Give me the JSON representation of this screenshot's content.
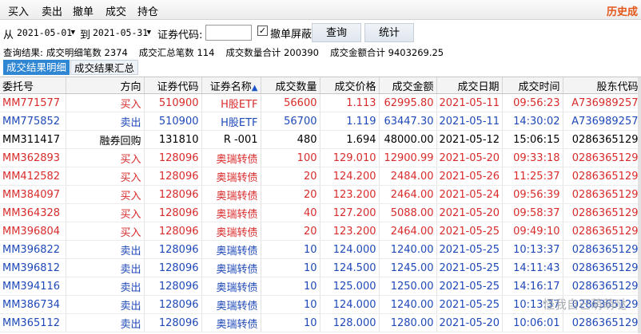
{
  "menu": {
    "items": [
      "买入",
      "卖出",
      "撤单",
      "成交",
      "持仓"
    ],
    "right_label": "历史成"
  },
  "toolbar": {
    "from_label": "从",
    "from_date": "2021-05-01",
    "to_label": "到",
    "to_date": "2021-05-31",
    "code_label": "证券代码:",
    "code_value": "",
    "filter_checked": true,
    "filter_label": "撤单屏蔽",
    "query_button": "查询",
    "stats_button": "统计"
  },
  "summary": {
    "prefix": "查询结果:",
    "detail_count": "成交明细笔数 2374",
    "summary_count": "成交汇总笔数 114",
    "qty_total": "成交数量合计 200390",
    "amount_total": "成交金额合计 9403269.25"
  },
  "tabs": [
    "成交结果明细",
    "成交结果汇总"
  ],
  "colors": {
    "buy": "#d92b2b",
    "sell": "#1f49b8",
    "neutral": "#000000",
    "tab_active": "#2f86d3",
    "header_right": "#e4571a"
  },
  "table": {
    "headers": [
      "委托号",
      "方向",
      "证券代码",
      "证券名称",
      "成交数量",
      "成交价格",
      "成交金额",
      "成交日期",
      "成交时间",
      "股东代码"
    ],
    "sort_indicator": "▲",
    "rows": [
      {
        "side": "buy",
        "cells": [
          "MM771577",
          "买入",
          "510900",
          "H股ETF",
          "56600",
          "1.113",
          "62995.80",
          "2021-05-11",
          "09:56:23",
          "A736989257"
        ]
      },
      {
        "side": "sell",
        "cells": [
          "MM775852",
          "卖出",
          "510900",
          "H股ETF",
          "56700",
          "1.119",
          "63447.30",
          "2021-05-11",
          "14:30:02",
          "A736989257"
        ]
      },
      {
        "side": "neutral",
        "cells": [
          "MM311417",
          "融券回购",
          "131810",
          "R -001",
          "480",
          "1.694",
          "48000.00",
          "2021-05-12",
          "15:06:15",
          "0286365129"
        ]
      },
      {
        "side": "buy",
        "cells": [
          "MM362893",
          "买入",
          "128096",
          "奥瑞转债",
          "100",
          "129.010",
          "12900.99",
          "2021-05-20",
          "09:33:18",
          "0286365129"
        ]
      },
      {
        "side": "buy",
        "cells": [
          "MM412582",
          "买入",
          "128096",
          "奥瑞转债",
          "20",
          "124.200",
          "2484.00",
          "2021-05-26",
          "11:25:37",
          "0286365129"
        ]
      },
      {
        "side": "buy",
        "cells": [
          "MM384097",
          "买入",
          "128096",
          "奥瑞转债",
          "20",
          "123.200",
          "2464.00",
          "2021-05-24",
          "09:56:39",
          "0286365129"
        ]
      },
      {
        "side": "buy",
        "cells": [
          "MM364328",
          "买入",
          "128096",
          "奥瑞转债",
          "40",
          "127.200",
          "5088.00",
          "2021-05-20",
          "09:58:37",
          "0286365129"
        ]
      },
      {
        "side": "buy",
        "cells": [
          "MM396804",
          "买入",
          "128096",
          "奥瑞转债",
          "20",
          "123.200",
          "2464.00",
          "2021-05-25",
          "09:49:10",
          "0286365129"
        ]
      },
      {
        "side": "sell",
        "cells": [
          "MM396822",
          "卖出",
          "128096",
          "奥瑞转债",
          "10",
          "124.000",
          "1240.00",
          "2021-05-25",
          "10:13:37",
          "0286365129"
        ]
      },
      {
        "side": "sell",
        "cells": [
          "MM396812",
          "卖出",
          "128096",
          "奥瑞转债",
          "10",
          "124.500",
          "1245.00",
          "2021-05-25",
          "14:11:43",
          "0286365129"
        ]
      },
      {
        "side": "sell",
        "cells": [
          "MM394116",
          "卖出",
          "128096",
          "奥瑞转债",
          "10",
          "125.000",
          "1250.00",
          "2021-05-25",
          "14:16:17",
          "0286365129"
        ]
      },
      {
        "side": "sell",
        "cells": [
          "MM386734",
          "卖出",
          "128096",
          "奥瑞转债",
          "10",
          "124.000",
          "1240.00",
          "2021-05-25",
          "10:13:37",
          "0286365129"
        ]
      },
      {
        "side": "sell",
        "cells": [
          "MM365112",
          "卖出",
          "128096",
          "奥瑞转债",
          "10",
          "128.000",
          "1280.00",
          "2021-05-20",
          "10:06:01",
          "0286365129"
        ]
      }
    ]
  },
  "watermark": "怪我自己萌萌哒"
}
